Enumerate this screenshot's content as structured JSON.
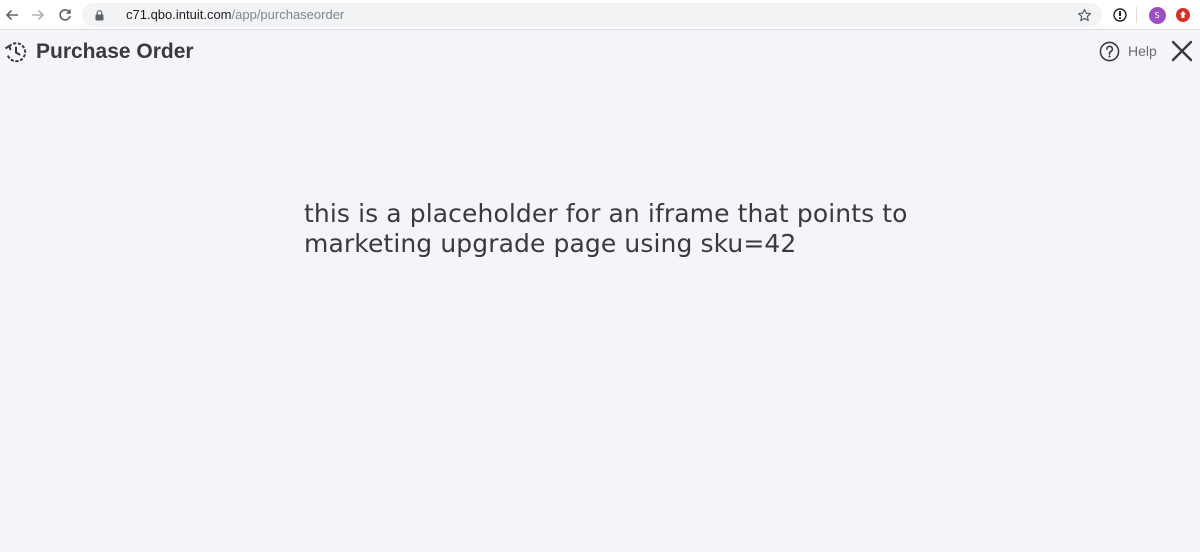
{
  "browser": {
    "url_host": "c71.qbo.intuit.com",
    "url_path": "/app/purchaseorder",
    "profile_initial": "S",
    "icons": {
      "back": "arrow-left-icon",
      "forward": "arrow-right-icon",
      "reload": "reload-icon",
      "lock": "lock-icon",
      "bookmark": "star-icon",
      "extension_info": "info-icon",
      "extension_red": "red-extension-icon"
    }
  },
  "header": {
    "title": "Purchase Order",
    "help_label": "Help",
    "icons": {
      "history": "history-icon",
      "help": "question-circle-icon",
      "close": "close-icon"
    }
  },
  "main": {
    "placeholder_lines": [
      "this is a placeholder for an iframe that points to",
      "marketing upgrade page using sku=42"
    ]
  },
  "colors": {
    "background": "#f4f5f8",
    "text": "#393a3d",
    "profile": "#9c4fc2",
    "extension_red": "#d93025"
  }
}
